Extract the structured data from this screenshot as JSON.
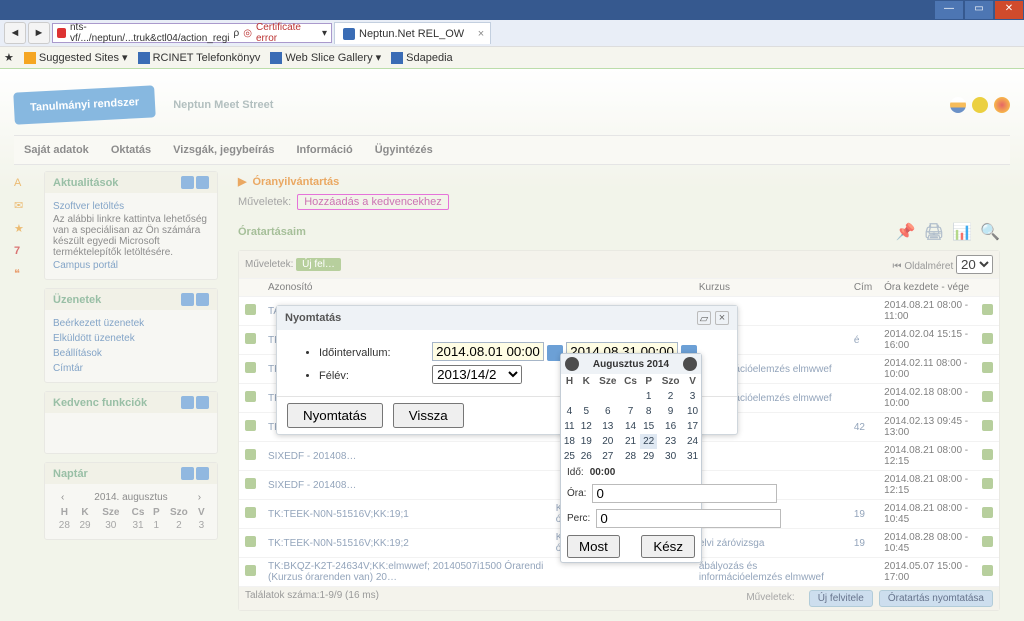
{
  "browser": {
    "url": "nts-vf/.../neptun/...truk&ctl04/action_regi",
    "search_ctrl": "ρ",
    "cert_icon": "◎",
    "cert_error": "Certificate error",
    "cert_chevron": "▾",
    "tab_title": "Neptun.Net REL_OW",
    "favorites": {
      "suggested": "Suggested Sites ▾",
      "rcinet": "RCINET Telefonkönyv",
      "slice": "Web Slice Gallery ▾",
      "sdapedia": "Sdapedia"
    }
  },
  "header": {
    "active_tab": "Tanulmányi rendszer",
    "inactive_tab": "Neptun Meet Street"
  },
  "menu": [
    "Saját adatok",
    "Oktatás",
    "Vizsgák, jegybeírás",
    "Információ",
    "Ügyintézés"
  ],
  "side": {
    "news_title": "Aktualitások",
    "news_link": "Szoftver letöltés",
    "news_body": "Az alábbi linkre kattintva lehetőség van a speciálisan az Ön számára készült egyedi Microsoft terméktelepítők letöltésére.",
    "news_link2": "Campus portál",
    "msg_title": "Üzenetek",
    "msg_items": [
      "Beérkezett üzenetek",
      "Elküldött üzenetek",
      "Beállítások",
      "Címtár"
    ],
    "fav_title": "Kedvenc funkciók",
    "cal_title": "Naptár",
    "cal_month": "2014. augusztus",
    "cal_dow": [
      "H",
      "K",
      "Sze",
      "Cs",
      "P",
      "Szo",
      "V"
    ],
    "cal_row": [
      "28",
      "29",
      "30",
      "31",
      "1",
      "2",
      "3"
    ]
  },
  "content": {
    "title": "Óranyilvántartás",
    "ops_label": "Műveletek:",
    "ops_btn": "Hozzáadás a kedvencekhez",
    "list_title": "Óratartásaim",
    "grid_ops": "Műveletek:",
    "grid_ops_btn": "Új fel…",
    "page_size_label": "Oldalméret",
    "page_size_value": "20",
    "cols": [
      "",
      "Azonosító",
      "",
      "Kurzus",
      "Cím",
      "Óra kezdete - vége",
      ""
    ],
    "rows": [
      [
        "TA9999 - 2014080…",
        "",
        "",
        "",
        "2014.08.21 08:00 - 11:00"
      ],
      [
        "TK:TKBQ-V02-62…",
        "",
        "",
        "é",
        "2014.02.04 15:15 - 16:00"
      ],
      [
        "TK:BKQZ-K2T-24…",
        "",
        "s információelemzés elmwwef",
        "",
        "2014.02.11 08:00 - 10:00"
      ],
      [
        "TK:BKQZ-K2T-24…",
        "",
        "s információelemzés elmwwef",
        "",
        "2014.02.18 08:00 - 10:00"
      ],
      [
        "TK:MKQO-K4A-8…",
        "",
        "",
        "42",
        "2014.02.13 09:45 - 13:00"
      ],
      [
        "SIXEDF - 201408…",
        "",
        "",
        "",
        "2014.08.21 08:00 - 12:15"
      ],
      [
        "SIXEDF - 201408…",
        "",
        "",
        "",
        "2014.08.21 08:00 - 12:15"
      ],
      [
        "TK:TEEK-N0N-51516V;KK:19;1",
        "Kurzus (A kurzus nincs az órarenden) 20…",
        "elvi záróvizsga",
        "19",
        "2014.08.21 08:00 - 10:45"
      ],
      [
        "TK:TEEK-N0N-51516V;KK:19;2",
        "Kurzus (A kurzus nincs az órarenden) 20…",
        "elvi záróvizsga",
        "19",
        "2014.08.28 08:00 - 10:45"
      ],
      [
        "TK:BKQZ-K2T-24634V;KK:elmwwef; 20140507i1500 Órarendi (Kurzus órarenden van) 20…",
        "",
        "ábályozás és információelemzés elmwwef",
        "",
        "2014.05.07 15:00 - 17:00"
      ]
    ],
    "footer": "Találatok száma:1-9/9 (16 ms)",
    "footer_ops": "Műveletek:",
    "footer_btn1": "Új felvitele",
    "footer_btn2": "Óratartás nyomtatása"
  },
  "dialog": {
    "title": "Nyomtatás",
    "f_interval": "Időintervallum:",
    "f_sem": "Félév:",
    "d_from": "2014.08.01 00:00",
    "d_to": "2014.08.31 00:00",
    "sem_value": "2013/14/2",
    "btn_print": "Nyomtatás",
    "btn_back": "Vissza"
  },
  "dp": {
    "month": "Augusztus 2014",
    "dow": [
      "H",
      "K",
      "Sze",
      "Cs",
      "P",
      "Szo",
      "V"
    ],
    "grid": [
      [
        "",
        "",
        "",
        "",
        "1",
        "2",
        "3"
      ],
      [
        "4",
        "5",
        "6",
        "7",
        "8",
        "9",
        "10"
      ],
      [
        "11",
        "12",
        "13",
        "14",
        "15",
        "16",
        "17"
      ],
      [
        "18",
        "19",
        "20",
        "21",
        "22",
        "23",
        "24"
      ],
      [
        "25",
        "26",
        "27",
        "28",
        "29",
        "30",
        "31"
      ]
    ],
    "time_label": "Idő:",
    "time_value": "00:00",
    "hour_label": "Óra:",
    "hour_value": "0",
    "min_label": "Perc:",
    "min_value": "0",
    "btn_now": "Most",
    "btn_done": "Kész"
  }
}
